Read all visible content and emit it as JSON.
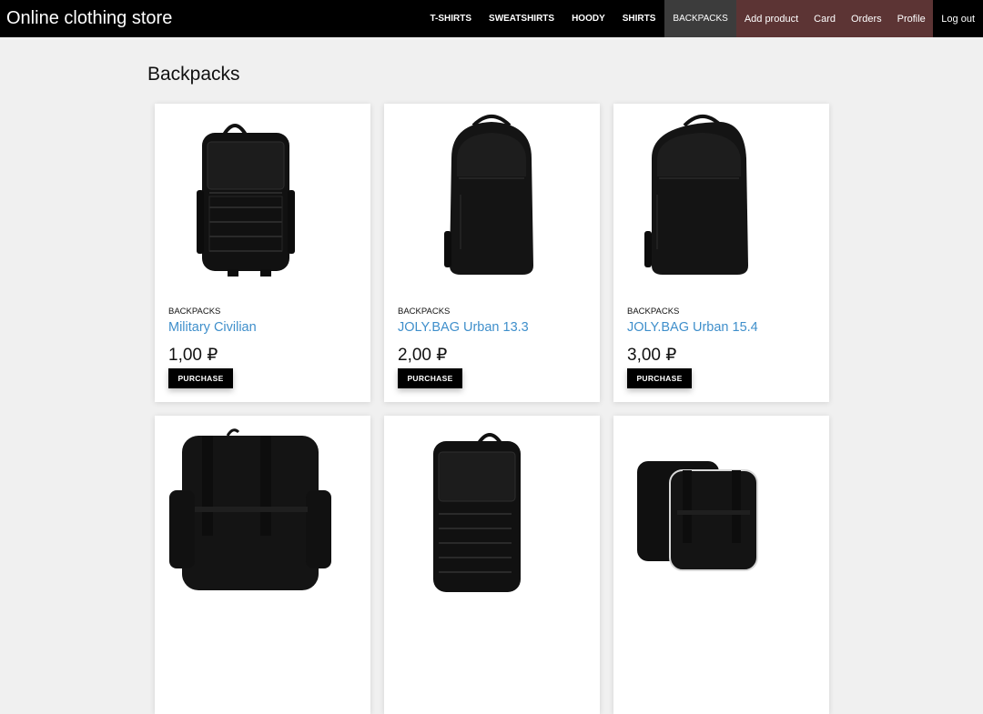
{
  "header": {
    "brand": "Online clothing store",
    "categories": [
      "T-SHIRTS",
      "SWEATSHIRTS",
      "HOODY",
      "SHIRTS",
      "BACKPACKS"
    ],
    "account": [
      "Add product",
      "Card",
      "Orders",
      "Profile"
    ],
    "logout": "Log out"
  },
  "main": {
    "title": "Backpacks",
    "products": [
      {
        "category": "BACKPACKS",
        "name": "Military Civilian",
        "price": "1,00 ₽",
        "button": "PURCHASE"
      },
      {
        "category": "BACKPACKS",
        "name": "JOLY.BAG Urban 13.3",
        "price": "2,00 ₽",
        "button": "PURCHASE"
      },
      {
        "category": "BACKPACKS",
        "name": "JOLY.BAG Urban 15.4",
        "price": "3,00 ₽",
        "button": "PURCHASE"
      },
      {
        "category": "",
        "name": "",
        "price": "",
        "button": ""
      },
      {
        "category": "",
        "name": "",
        "price": "",
        "button": ""
      },
      {
        "category": "",
        "name": "",
        "price": "",
        "button": ""
      }
    ]
  },
  "colors": {
    "topbar": "#000000",
    "active_tab": "#3c3c3c",
    "account_tabs": "#5c3434",
    "link": "#3f8fcb",
    "page_bg": "#f0f0f0"
  }
}
